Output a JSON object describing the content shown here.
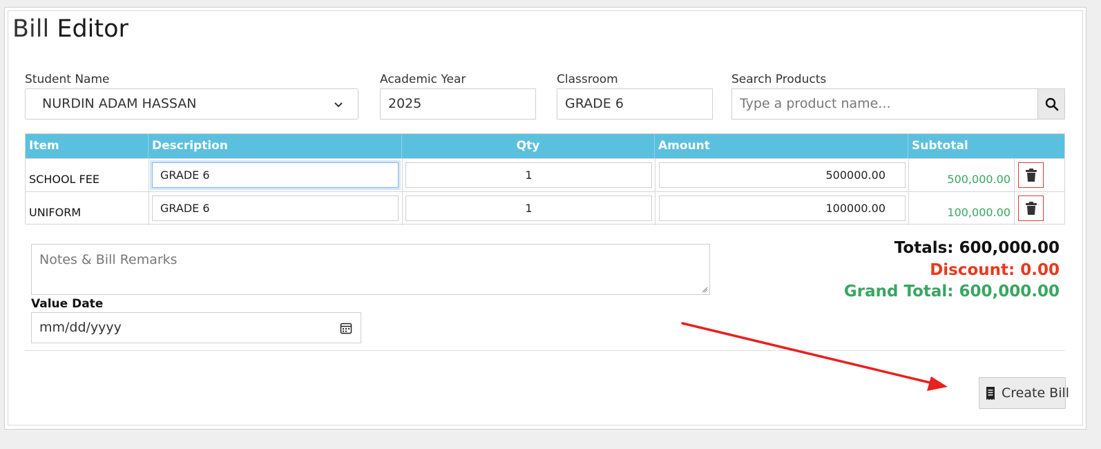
{
  "page": {
    "title_part1": "Bill",
    "title_part2": "Editor"
  },
  "form": {
    "student_name_label": "Student Name",
    "student_name_value": "NURDIN ADAM HASSAN",
    "academic_year_label": "Academic Year",
    "academic_year_value": "2025",
    "classroom_label": "Classroom",
    "classroom_value": "GRADE 6",
    "search_label": "Search Products",
    "search_placeholder": "Type a product name..."
  },
  "table": {
    "headers": [
      "Item",
      "Description",
      "Qty",
      "Amount",
      "Subtotal"
    ],
    "rows": [
      {
        "item": "SCHOOL FEE",
        "description": "GRADE 6",
        "qty": "1",
        "amount": "500000.00",
        "subtotal": "500,000.00"
      },
      {
        "item": "UNIFORM",
        "description": "GRADE 6",
        "qty": "1",
        "amount": "100000.00",
        "subtotal": "100,000.00"
      }
    ]
  },
  "notes": {
    "placeholder": "Notes & Bill Remarks"
  },
  "value_date": {
    "label": "Value Date",
    "placeholder": "mm/dd/yyyy"
  },
  "totals": {
    "totals": "Totals: 600,000.00",
    "discount": "Discount: 0.00",
    "grand_total": "Grand Total: 600,000.00"
  },
  "actions": {
    "create_bill_label": "Create Bill"
  },
  "colors": {
    "header_bg": "#5bc0de",
    "subtotal_green": "#3aa561",
    "discount_red": "#e8391f",
    "grand_total_green": "#3aa561",
    "annotation_arrow": "#e8201e"
  },
  "icons": {
    "student_select": "chevron-down-icon",
    "search": "search-icon",
    "delete": "trash-icon",
    "date": "calendar-icon",
    "create_bill": "receipt-icon"
  }
}
